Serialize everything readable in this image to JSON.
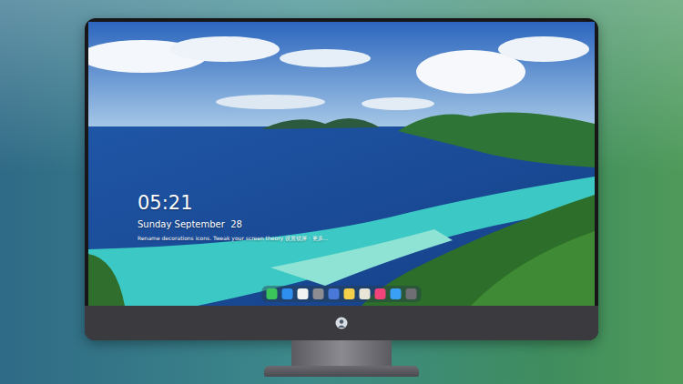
{
  "lock_screen": {
    "time": "05:21",
    "date": "Sunday September  28",
    "hint": "Rename decorations icons. Tweak your screen theory 设置锁屏 · 更多..."
  },
  "dock": {
    "apps": [
      {
        "color": "#3bc45a"
      },
      {
        "color": "#2f8ff0"
      },
      {
        "color": "#f2f2f2"
      },
      {
        "color": "#8c8c92"
      },
      {
        "color": "#4a78d8"
      },
      {
        "color": "#f5d04a"
      },
      {
        "color": "#e9e4d8"
      },
      {
        "color": "#f0447a"
      },
      {
        "color": "#3aa0f5"
      },
      {
        "color": "#6e6e74"
      }
    ]
  }
}
